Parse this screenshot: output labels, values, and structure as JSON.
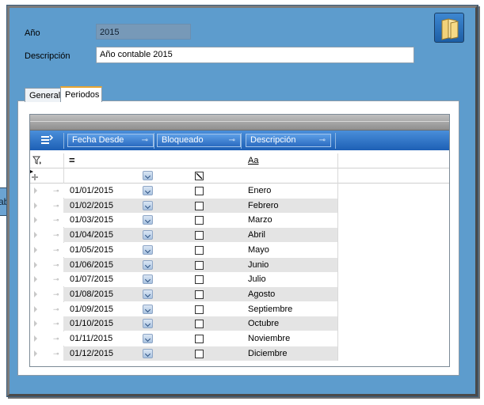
{
  "header": {
    "year_label": "Año",
    "year_value": "2015",
    "description_label": "Descripción",
    "description_value": "Año contable 2015",
    "open_button_icon": "folder-icon"
  },
  "side_tab": {
    "label": "ab"
  },
  "tabs": [
    {
      "label": "General",
      "active": false
    },
    {
      "label": "Periodos",
      "active": true
    }
  ],
  "grid": {
    "columns": [
      {
        "label": "Fecha Desde"
      },
      {
        "label": "Bloqueado"
      },
      {
        "label": "Descripción"
      }
    ],
    "filter_row": {
      "fecha_operator": "=",
      "descripcion_operator": "Aa"
    },
    "rows": [
      {
        "fecha": "01/01/2015",
        "bloqueado": false,
        "descripcion": "Enero"
      },
      {
        "fecha": "01/02/2015",
        "bloqueado": false,
        "descripcion": "Febrero"
      },
      {
        "fecha": "01/03/2015",
        "bloqueado": false,
        "descripcion": "Marzo"
      },
      {
        "fecha": "01/04/2015",
        "bloqueado": false,
        "descripcion": "Abril"
      },
      {
        "fecha": "01/05/2015",
        "bloqueado": false,
        "descripcion": "Mayo"
      },
      {
        "fecha": "01/06/2015",
        "bloqueado": false,
        "descripcion": "Junio"
      },
      {
        "fecha": "01/07/2015",
        "bloqueado": false,
        "descripcion": "Julio"
      },
      {
        "fecha": "01/08/2015",
        "bloqueado": false,
        "descripcion": "Agosto"
      },
      {
        "fecha": "01/09/2015",
        "bloqueado": false,
        "descripcion": "Septiembre"
      },
      {
        "fecha": "01/10/2015",
        "bloqueado": false,
        "descripcion": "Octubre"
      },
      {
        "fecha": "01/11/2015",
        "bloqueado": false,
        "descripcion": "Noviembre"
      },
      {
        "fecha": "01/12/2015",
        "bloqueado": false,
        "descripcion": "Diciembre"
      }
    ]
  },
  "colors": {
    "window_background": "#5d9ccd",
    "grid_header": "#2b6bc0",
    "active_tab_accent": "#e8a532"
  }
}
